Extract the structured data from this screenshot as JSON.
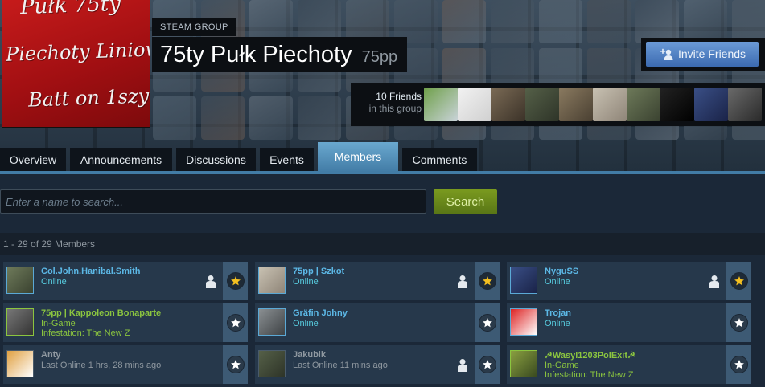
{
  "header": {
    "group_label": "STEAM GROUP",
    "group_name": "75ty Pułk Piechoty",
    "group_abbr": "75pp",
    "avatar_text": [
      "Pułk 75ty",
      "Piechoty Liniowey",
      "Batt on 1szy"
    ],
    "invite_button": "Invite Friends",
    "friends_count": "10 Friends",
    "friends_sub": "in this group",
    "friend_avatar_icons": [
      "minecraft-avatar-icon",
      "x-crown-avatar-icon",
      "stalin-avatar-icon",
      "soldier-helmet-avatar-icon",
      "soldier-crowd-avatar-icon",
      "cat-avatar-icon",
      "soldier-avatar-icon",
      "white-emblem-avatar-icon",
      "blue-creature-avatar-icon",
      "bald-man-avatar-icon"
    ]
  },
  "tabs": [
    {
      "label": "Overview",
      "active": false
    },
    {
      "label": "Announcements",
      "active": false
    },
    {
      "label": "Discussions",
      "active": false
    },
    {
      "label": "Events",
      "active": false
    },
    {
      "label": "Members",
      "active": true
    },
    {
      "label": "Comments",
      "active": false
    }
  ],
  "search": {
    "placeholder": "Enter a name to search...",
    "button": "Search"
  },
  "members_count": "1 - 29 of 29 Members",
  "members": [
    {
      "name": "Col.John.Hanibal.Smith",
      "status": "Online",
      "game": "",
      "state": "online",
      "friend": true,
      "officer": true
    },
    {
      "name": "75pp | Szkot",
      "status": "Online",
      "game": "",
      "state": "online",
      "friend": true,
      "officer": true
    },
    {
      "name": "NyguSS",
      "status": "Online",
      "game": "",
      "state": "online",
      "friend": true,
      "officer": true
    },
    {
      "name": "75pp | Kappoleon Bonaparte",
      "status": "In-Game",
      "game": "Infestation: The New Z",
      "state": "ingame",
      "friend": false,
      "officer": false
    },
    {
      "name": "Gräfin Johny",
      "status": "Online",
      "game": "",
      "state": "online",
      "friend": false,
      "officer": false
    },
    {
      "name": "Trojan",
      "status": "Online",
      "game": "",
      "state": "online",
      "friend": false,
      "officer": false
    },
    {
      "name": "Anty",
      "status": "Last Online 1 hrs, 28 mins ago",
      "game": "",
      "state": "offline",
      "friend": false,
      "officer": false
    },
    {
      "name": "Jakubik",
      "status": "Last Online 11 mins ago",
      "game": "",
      "state": "offline",
      "friend": true,
      "officer": false
    },
    {
      "name": "☭Wasyl1203PolExit☭",
      "status": "In-Game",
      "game": "Infestation: The New Z",
      "state": "ingame",
      "friend": false,
      "officer": false
    }
  ],
  "colors": {
    "background": "#1b2838",
    "tab_active": "#427ca6",
    "online": "#5cb8e6",
    "ingame": "#8bc53f",
    "offline": "#8f98a0",
    "officer_star": "#f4c020",
    "member_star": "#ffffff"
  }
}
